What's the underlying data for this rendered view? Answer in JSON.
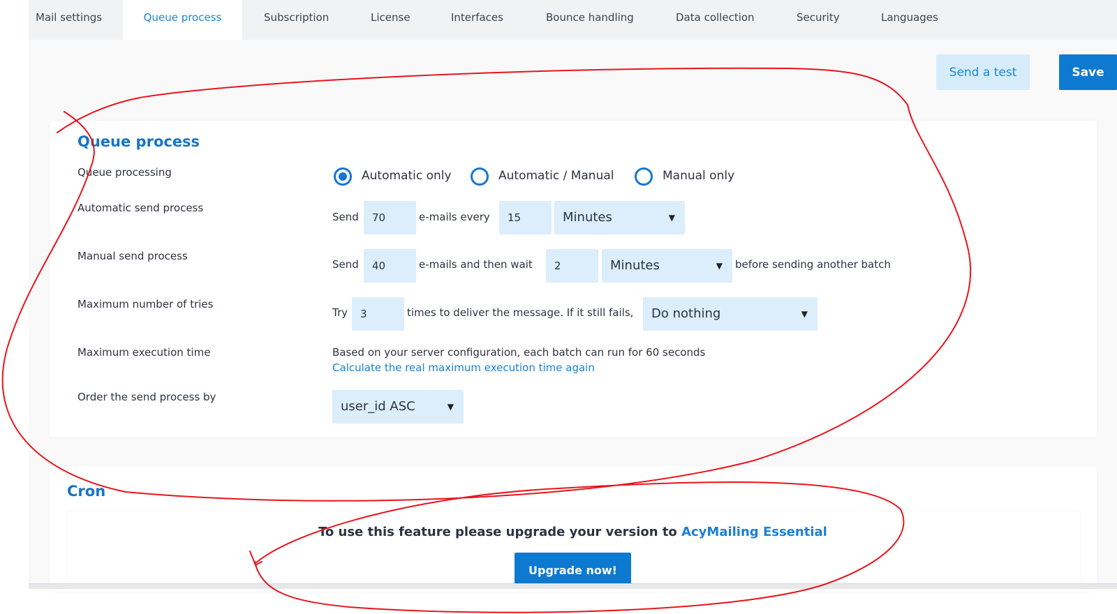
{
  "tabs": [
    {
      "label": "Mail settings",
      "active": false
    },
    {
      "label": "Queue process",
      "active": true
    },
    {
      "label": "Subscription",
      "active": false
    },
    {
      "label": "License",
      "active": false
    },
    {
      "label": "Interfaces",
      "active": false
    },
    {
      "label": "Bounce handling",
      "active": false
    },
    {
      "label": "Data collection",
      "active": false
    },
    {
      "label": "Security",
      "active": false
    },
    {
      "label": "Languages",
      "active": false
    }
  ],
  "toolbar": {
    "send_test_label": "Send a test",
    "save_label": "Save"
  },
  "queue": {
    "title": "Queue process",
    "processing": {
      "label": "Queue processing",
      "options": [
        "Automatic only",
        "Automatic / Manual",
        "Manual only"
      ],
      "selected": "Automatic only"
    },
    "auto_send": {
      "label": "Automatic send process",
      "prefix": "Send",
      "count": "70",
      "middle": "e-mails every",
      "interval": "15",
      "unit": "Minutes"
    },
    "manual_send": {
      "label": "Manual send process",
      "prefix": "Send",
      "count": "40",
      "middle": "e-mails and then wait",
      "wait": "2",
      "unit": "Minutes",
      "suffix": "before sending another batch"
    },
    "max_tries": {
      "label": "Maximum number of tries",
      "prefix": "Try",
      "count": "3",
      "middle": "times to deliver the message. If it still fails,",
      "action": "Do nothing"
    },
    "max_exec": {
      "label": "Maximum execution time",
      "text": "Based on your server configuration, each batch can run for 60 seconds",
      "link": "Calculate the real maximum execution time again"
    },
    "order": {
      "label": "Order the send process by",
      "value": "user_id ASC"
    }
  },
  "cron": {
    "title": "Cron",
    "upgrade_text": "To use this feature please upgrade your version to",
    "upgrade_link": "AcyMailing Essential",
    "upgrade_button": "Upgrade now!"
  },
  "colors": {
    "accent": "#0d79d1",
    "link": "#1b7fd2",
    "field_bg": "#dceefb",
    "annotation": "#e8141b"
  }
}
